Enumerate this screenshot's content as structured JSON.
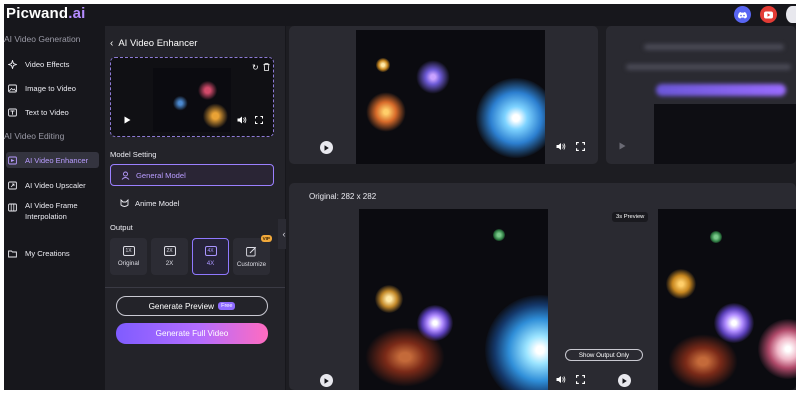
{
  "app": {
    "logo_main": "Picwand",
    "logo_accent": ".ai"
  },
  "header": {
    "icons": [
      "discord-icon",
      "youtube-icon"
    ]
  },
  "nav": {
    "section_generation": "AI Video Generation",
    "section_editing": "AI Video Editing",
    "items": [
      {
        "label": "Video Effects",
        "icon": "effects-icon"
      },
      {
        "label": "Image to Video",
        "icon": "image-icon"
      },
      {
        "label": "Text to Video",
        "icon": "text-icon"
      },
      {
        "label": "AI Video Enhancer",
        "icon": "enhance-icon",
        "active": true
      },
      {
        "label": "AI Video Upscaler",
        "icon": "upscale-icon"
      },
      {
        "label": "AI Video Frame",
        "label2": "Interpolation",
        "icon": "frame-icon"
      },
      {
        "label": "My Creations",
        "icon": "folder-icon"
      }
    ]
  },
  "panel": {
    "title": "AI Video Enhancer",
    "model_setting_label": "Model Setting",
    "models": [
      {
        "label": "General Model",
        "selected": true
      },
      {
        "label": "Anime Model",
        "selected": false
      }
    ],
    "output_label": "Output",
    "outputs": [
      {
        "box": "1X",
        "label": "Original",
        "selected": false
      },
      {
        "box": "2X",
        "label": "2X",
        "selected": false
      },
      {
        "box": "4X",
        "label": "4X",
        "selected": true
      },
      {
        "box": "",
        "label": "Customize",
        "selected": false,
        "badge": "VIP"
      }
    ],
    "preview_button": "Generate Preview",
    "preview_badge": "Free",
    "full_button": "Generate Full Video"
  },
  "result": {
    "original_label": "Original: 282 x 282",
    "show_output_button": "Show Output Only",
    "preview_badge": "3s Preview"
  },
  "colors": {
    "accent": "#9b80ff",
    "background": "#17171c",
    "panel": "#232329"
  }
}
